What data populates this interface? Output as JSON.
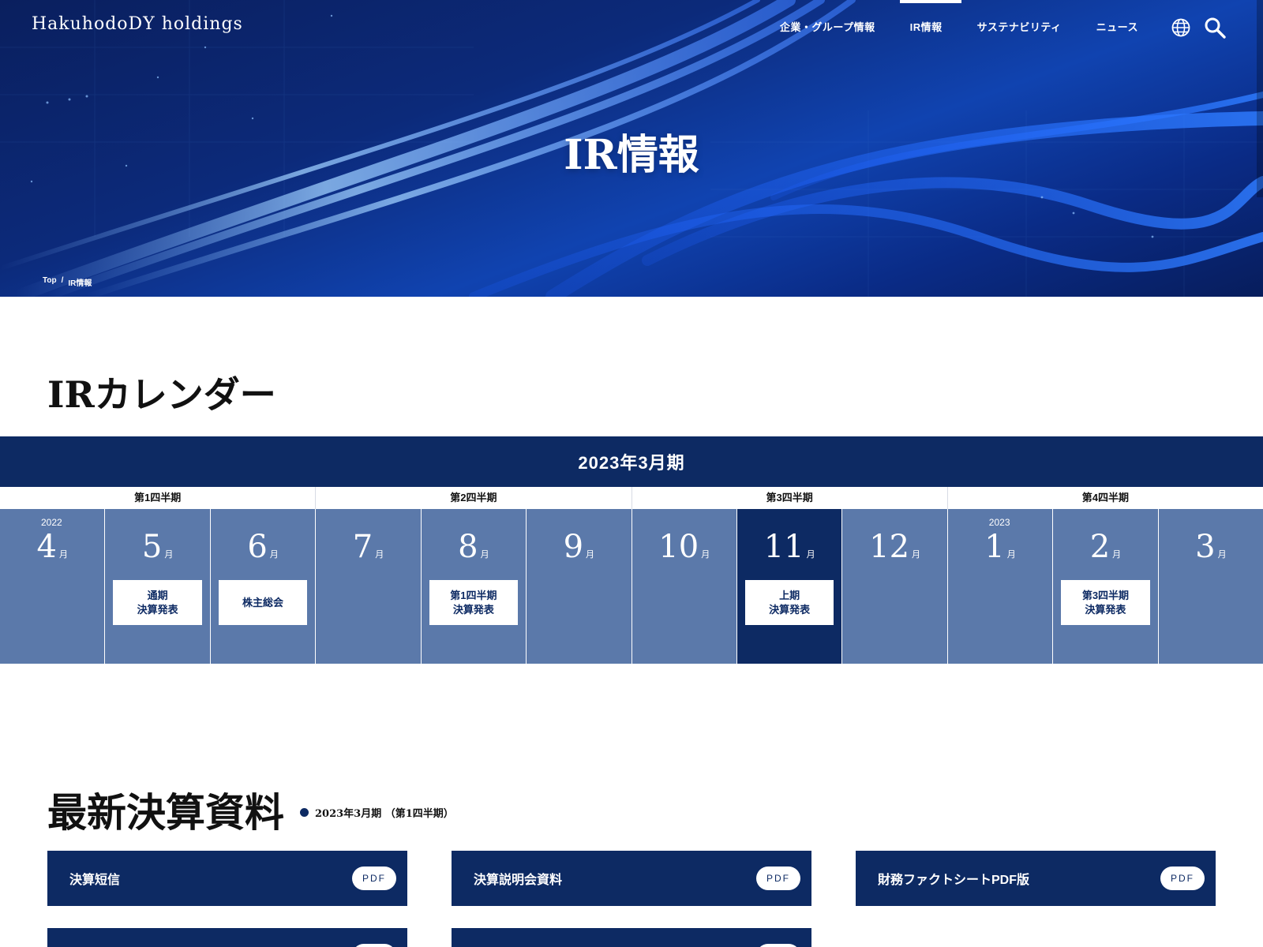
{
  "header": {
    "logo": "HakuhodoDY holdings",
    "nav": [
      "企業・グループ情報",
      "IR情報",
      "サステナビリティ",
      "ニュース"
    ],
    "icons": [
      "globe-icon",
      "search-icon"
    ]
  },
  "hero": {
    "title": "IR情報",
    "breadcrumb": [
      "Top",
      "/",
      "IR情報"
    ]
  },
  "calendar": {
    "title": "IRカレンダー",
    "fiscal_year": "2023年3月期",
    "quarters": [
      "第1四半期",
      "第2四半期",
      "第3四半期",
      "第4四半期"
    ],
    "month_suffix": "月",
    "months": [
      {
        "year": "2022",
        "month": "4",
        "event": ""
      },
      {
        "year": "",
        "month": "5",
        "event": "通期\n決算発表"
      },
      {
        "year": "",
        "month": "6",
        "event": "株主総会"
      },
      {
        "year": "",
        "month": "7",
        "event": ""
      },
      {
        "year": "",
        "month": "8",
        "event": "第1四半期\n決算発表"
      },
      {
        "year": "",
        "month": "9",
        "event": ""
      },
      {
        "year": "",
        "month": "10",
        "event": ""
      },
      {
        "year": "",
        "month": "11",
        "event": "上期\n決算発表",
        "active": true
      },
      {
        "year": "",
        "month": "12",
        "event": ""
      },
      {
        "year": "2023",
        "month": "1",
        "event": ""
      },
      {
        "year": "",
        "month": "2",
        "event": "第3四半期\n決算発表"
      },
      {
        "year": "",
        "month": "3",
        "event": ""
      }
    ]
  },
  "materials": {
    "title": "最新決算資料",
    "period": "2023年3月期 （第1四半期）",
    "cards": [
      {
        "label": "決算短信",
        "badge": "PDF"
      },
      {
        "label": "決算説明会資料",
        "badge": "PDF"
      },
      {
        "label": "財務ファクトシートPDF版",
        "badge": "PDF"
      },
      {
        "label": "",
        "badge": ""
      },
      {
        "label": "",
        "badge": ""
      }
    ]
  },
  "colors": {
    "navy": "#0d2a63",
    "month_tile": "#5b79aa",
    "hero_blue": "#1043b0"
  }
}
